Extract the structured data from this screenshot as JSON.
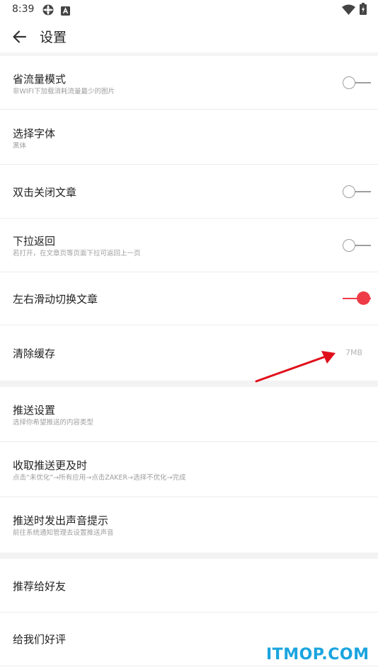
{
  "status_bar": {
    "time": "8:39",
    "icons": [
      "brightness-icon",
      "app-notification-icon",
      "wifi-icon",
      "battery-charging-icon"
    ]
  },
  "header": {
    "title": "设置",
    "back_icon": "arrow-left-icon"
  },
  "sections": [
    {
      "items": [
        {
          "title": "省流量模式",
          "subtitle": "非WIFI下加载消耗流量最少的图片",
          "control": "toggle",
          "on": false
        },
        {
          "title": "选择字体",
          "subtitle": "黑体",
          "control": "none"
        },
        {
          "title": "双击关闭文章",
          "control": "toggle",
          "on": false
        },
        {
          "title": "下拉返回",
          "subtitle": "若打开，在文章页等页面下拉可返回上一页",
          "control": "toggle",
          "on": false
        },
        {
          "title": "左右滑动切换文章",
          "control": "toggle",
          "on": true
        },
        {
          "title": "清除缓存",
          "value": "7MB",
          "control": "value"
        }
      ]
    },
    {
      "items": [
        {
          "title": "推送设置",
          "subtitle": "选择你希望推送的内容类型"
        },
        {
          "title": "收取推送更及时",
          "subtitle": "点击“未优化”→所有应用→点击ZAKER→选择不优化→完成"
        },
        {
          "title": "推送时发出声音提示",
          "subtitle": "前往系统通知管理去设置推送声音"
        }
      ]
    },
    {
      "items": [
        {
          "title": "推荐给好友"
        },
        {
          "title": "给我们好评"
        }
      ]
    }
  ],
  "watermark": "ITMOP.COM",
  "colors": {
    "accent": "#ef3b47",
    "watermark": "#1aa4df",
    "annotation_arrow": "#e0101b"
  }
}
